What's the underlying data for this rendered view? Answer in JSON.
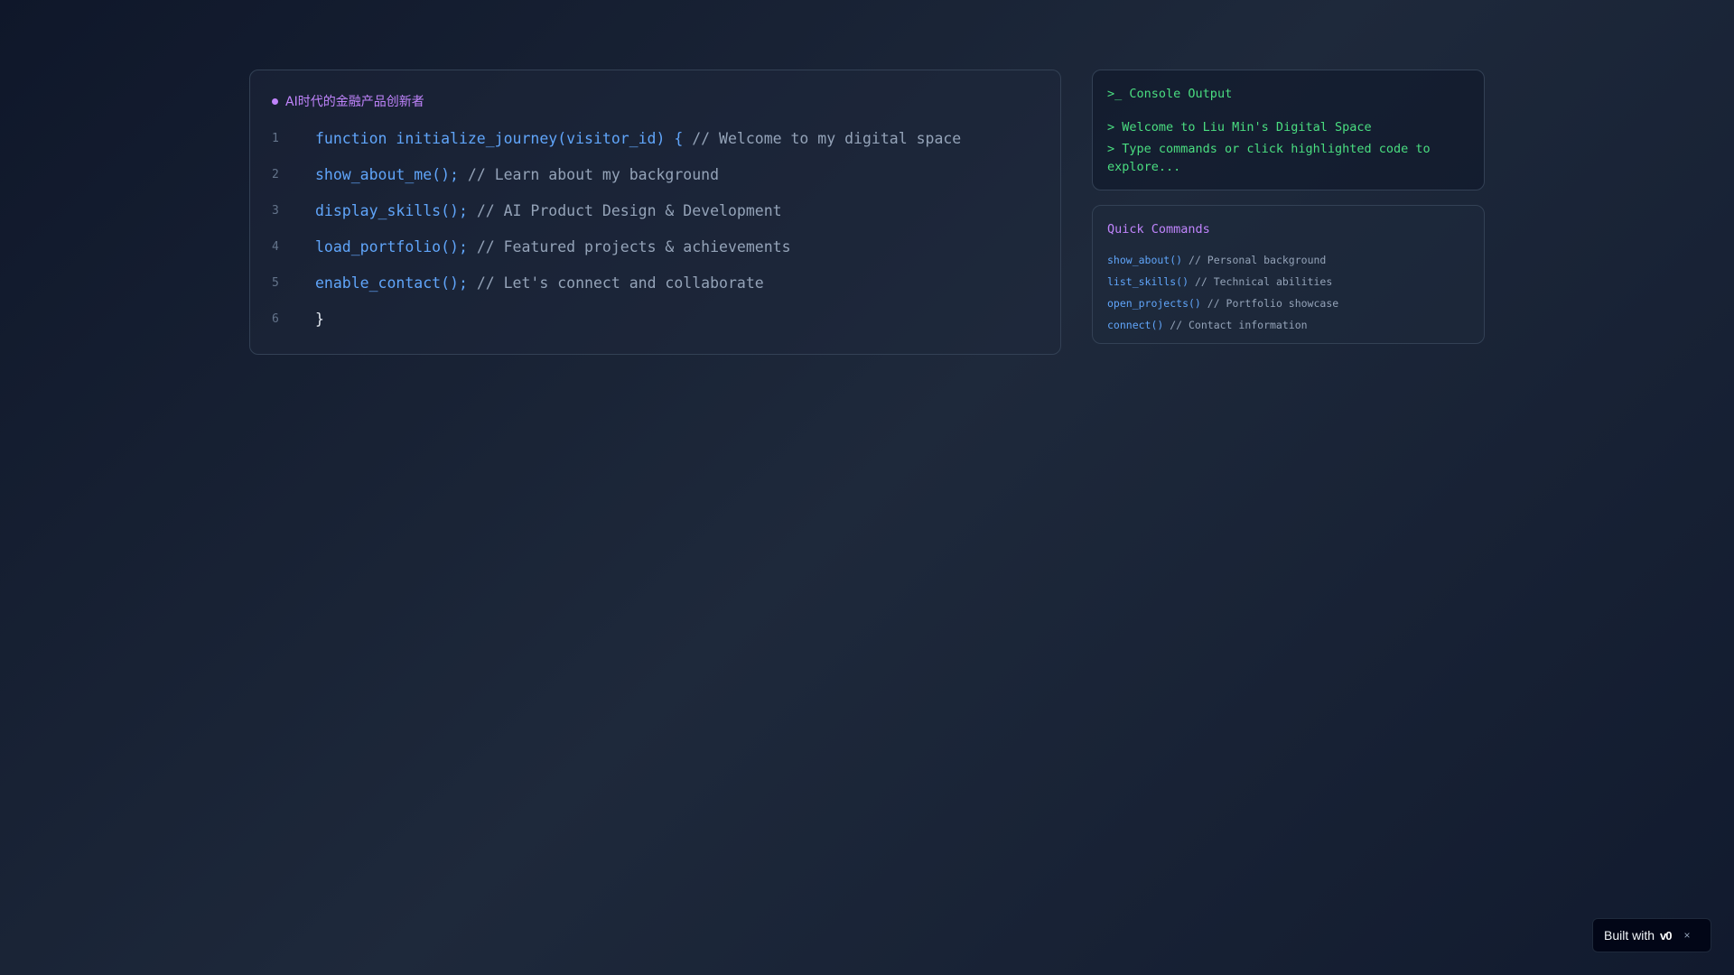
{
  "editor": {
    "header": "AI时代的金融产品创新者",
    "lines": [
      {
        "num": "1",
        "code": "function initialize_journey(visitor_id) {",
        "comment": " // Welcome to my digital space"
      },
      {
        "num": "2",
        "code": "show_about_me();",
        "comment": " // Learn about my background"
      },
      {
        "num": "3",
        "code": "display_skills();",
        "comment": " // AI Product Design & Development"
      },
      {
        "num": "4",
        "code": "load_portfolio();",
        "comment": " // Featured projects & achievements"
      },
      {
        "num": "5",
        "code": "enable_contact();",
        "comment": " // Let's connect and collaborate"
      },
      {
        "num": "6",
        "brace": "}"
      }
    ]
  },
  "console": {
    "prompt_icon": ">_",
    "title": "Console Output",
    "lines": [
      "> Welcome to Liu Min's Digital Space",
      "> Type commands or click highlighted code to explore..."
    ]
  },
  "quick_commands": {
    "title": "Quick Commands",
    "items": [
      {
        "cmd": "show_about()",
        "desc": " // Personal background"
      },
      {
        "cmd": "list_skills()",
        "desc": " // Technical abilities"
      },
      {
        "cmd": "open_projects()",
        "desc": " // Portfolio showcase"
      },
      {
        "cmd": "connect()",
        "desc": " // Contact information"
      }
    ]
  },
  "badge": {
    "label": "Built with",
    "logo": "v0",
    "close": "×"
  },
  "colors": {
    "accent_blue": "#60a5fa",
    "accent_purple": "#c084fc",
    "console_green": "#4ade80",
    "comment_gray": "#94a3b8"
  }
}
